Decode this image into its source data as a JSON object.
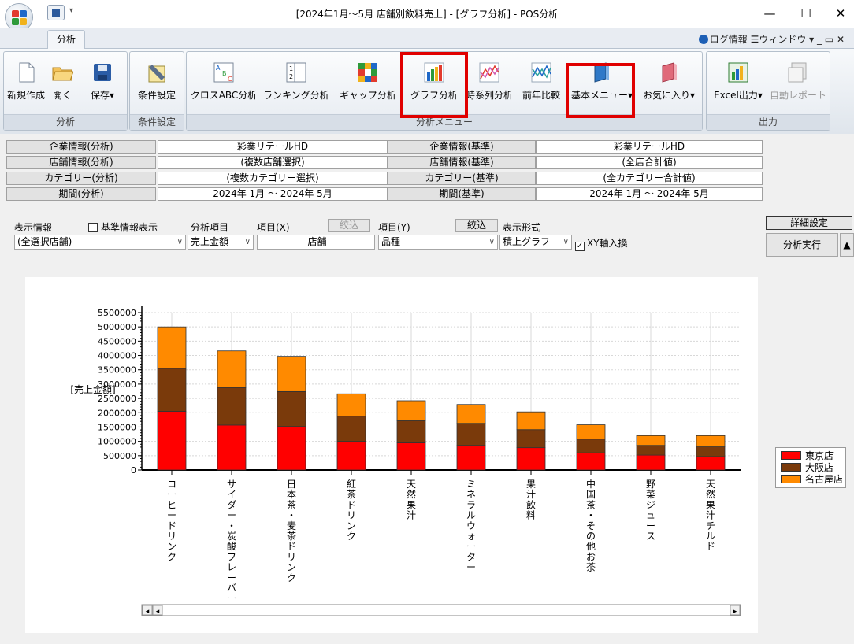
{
  "window": {
    "title": "[2024年1月～5月 店舗別飲料売上] - [グラフ分析] - POS分析",
    "minimize": "—",
    "maximize": "☐",
    "close": "✕"
  },
  "ribbon_tabs": {
    "active": "分析",
    "right": "ログ情報 ☰ウィンドウ ▾ _ ▭ ✕"
  },
  "ribbon": {
    "groups": [
      {
        "label": "分析",
        "buttons": [
          {
            "label": "新規作成",
            "icon": "new-document-icon"
          },
          {
            "label": "開く",
            "icon": "folder-open-icon"
          },
          {
            "label": "保存▾",
            "icon": "save-disk-icon"
          }
        ]
      },
      {
        "label": "条件設定",
        "buttons": [
          {
            "label": "条件設定",
            "icon": "condition-settings-icon"
          }
        ]
      },
      {
        "label": "分析メニュー",
        "buttons": [
          {
            "label": "クロスABC分析",
            "icon": "cross-abc-icon"
          },
          {
            "label": "ランキング分析",
            "icon": "ranking-icon"
          },
          {
            "label": "ギャップ分析",
            "icon": "gap-analysis-icon"
          },
          {
            "label": "グラフ分析",
            "icon": "bar-chart-icon"
          },
          {
            "label": "時系列分析",
            "icon": "time-series-icon"
          },
          {
            "label": "前年比較",
            "icon": "year-compare-icon"
          },
          {
            "label": "基本メニュー▾",
            "icon": "book-blue-icon"
          },
          {
            "label": "お気に入り▾",
            "icon": "book-red-icon"
          }
        ]
      },
      {
        "label": "出力",
        "buttons": [
          {
            "label": "Excel出力▾",
            "icon": "excel-export-icon"
          },
          {
            "label": "自動レポート",
            "icon": "auto-report-icon"
          }
        ]
      }
    ]
  },
  "info": {
    "rows": [
      {
        "h1": "企業情報(分析)",
        "v1": "彩業リテールHD",
        "h2": "企業情報(基準)",
        "v2": "彩業リテールHD"
      },
      {
        "h1": "店舗情報(分析)",
        "v1": "(複数店舗選択)",
        "h2": "店舗情報(基準)",
        "v2": "(全店合計値)"
      },
      {
        "h1": "カテゴリー(分析)",
        "v1": "(複数カテゴリー選択)",
        "h2": "カテゴリー(基準)",
        "v2": "(全カテゴリー合計値)"
      },
      {
        "h1": "期間(分析)",
        "v1": "2024年 1月 ～ 2024年 5月",
        "h2": "期間(基準)",
        "v2": "2024年 1月 ～ 2024年 5月"
      }
    ]
  },
  "controls": {
    "display_info": "表示情報",
    "base_info_checkbox": "基準情報表示",
    "analysis_item": "分析項目",
    "item_x": "項目(X)",
    "filter_x": "絞込",
    "item_y": "項目(Y)",
    "filter_y": "絞込",
    "display_format": "表示形式",
    "detail_settings": "詳細設定",
    "store_select": "(全選択店舗)",
    "metric_select": "売上金額",
    "x_value": "店舗",
    "y_select": "品種",
    "format_select": "積上グラフ",
    "swap_checkbox": "XY軸入換",
    "run": "分析実行",
    "collapse": "▲"
  },
  "chart_data": {
    "type": "bar",
    "stacked": true,
    "ylabel": "[売上金額]",
    "ylim": [
      0,
      5500000
    ],
    "yticks": [
      "5500000",
      "5000000",
      "4500000",
      "4000000",
      "3500000",
      "3000000",
      "2500000",
      "2000000",
      "1500000",
      "1000000",
      "500000",
      "0"
    ],
    "categories": [
      "コーヒードリンク",
      "サイダー・炭酸フレーバー",
      "日本茶・麦茶ドリンク",
      "紅茶ドリンク",
      "天然果汁",
      "ミネラルウォーター",
      "果汁飲料",
      "中国茶・その他お茶",
      "野菜ジュース",
      "天然果汁チルド"
    ],
    "series": [
      {
        "name": "東京店",
        "color": "#ff0000",
        "values": [
          2050000,
          1570000,
          1520000,
          1000000,
          950000,
          860000,
          780000,
          600000,
          520000,
          470000
        ]
      },
      {
        "name": "大阪店",
        "color": "#7a3a0b",
        "values": [
          1500000,
          1310000,
          1220000,
          880000,
          770000,
          770000,
          630000,
          480000,
          340000,
          340000
        ]
      },
      {
        "name": "名古屋店",
        "color": "#ff8a00",
        "values": [
          1450000,
          1280000,
          1230000,
          780000,
          700000,
          660000,
          620000,
          500000,
          340000,
          390000
        ]
      }
    ],
    "legend": "right",
    "grid": true
  }
}
